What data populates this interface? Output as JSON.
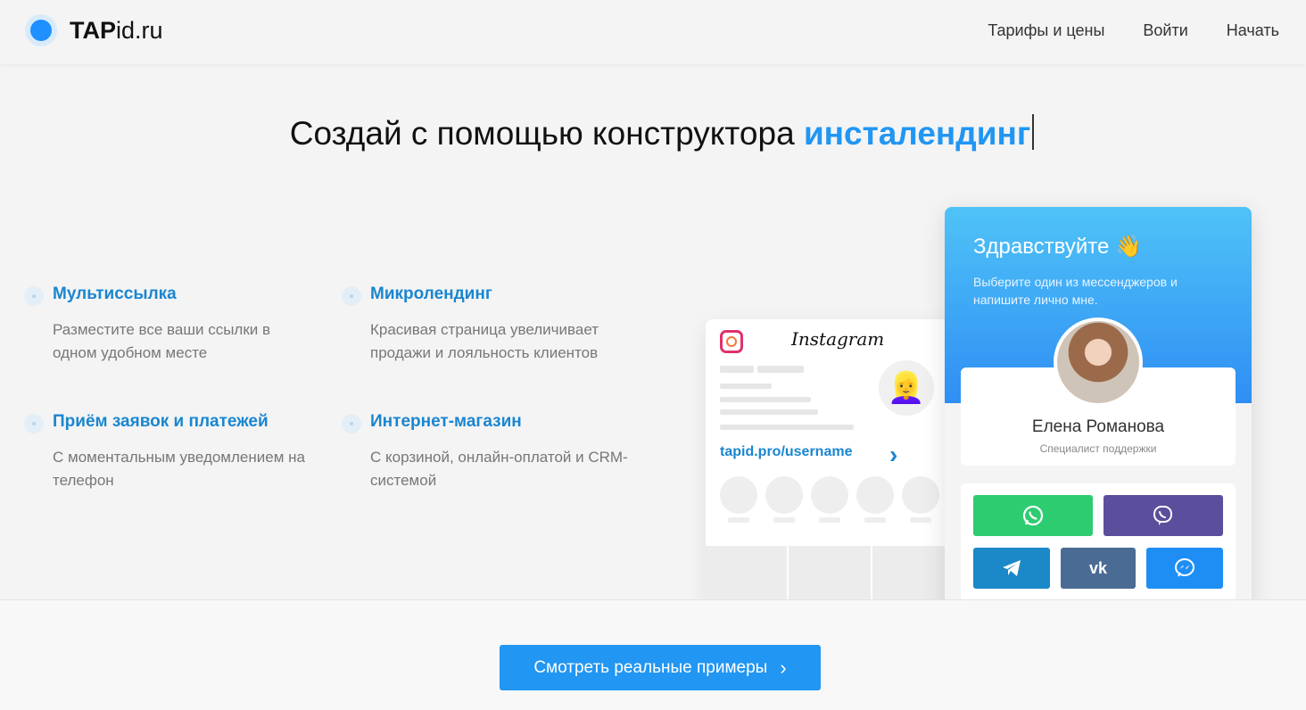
{
  "header": {
    "logo_bold": "TAP",
    "logo_rest": "id.ru",
    "nav": [
      "Тарифы и цены",
      "Войти",
      "Начать"
    ]
  },
  "headline": {
    "text": "Создай с помощью конструктора ",
    "accent": "инсталендинг"
  },
  "features": [
    {
      "title": "Мультиссылка",
      "desc": "Разместите все ваши ссылки в одном удобном месте"
    },
    {
      "title": "Микролендинг",
      "desc": "Красивая страница увеличивает продажи и лояльность клиентов"
    },
    {
      "title": "Приём заявок и платежей",
      "desc": "С моментальным уведомлением на телефон"
    },
    {
      "title": "Интернет-магазин",
      "desc": "С корзиной, онлайн-оплатой и CRM-системой"
    }
  ],
  "instagram": {
    "wordmark": "Instagram",
    "link": "tapid.pro/username",
    "avatar_emoji": "👱‍♀️"
  },
  "profile": {
    "hello": "Здравствуйте 👋",
    "sub": "Выберите один из мессенджеров и напишите лично мне.",
    "name": "Елена Романова",
    "role": "Специалист поддержки",
    "messengers": [
      {
        "name": "whatsapp-icon",
        "color": "#2ecc71"
      },
      {
        "name": "viber-icon",
        "color": "#5b4e9c"
      },
      {
        "name": "telegram-icon",
        "color": "#1b88c8"
      },
      {
        "name": "vk-icon",
        "color": "#4a6b94"
      },
      {
        "name": "messenger-icon",
        "color": "#1e8ef5"
      }
    ]
  },
  "cta": {
    "label": "Смотреть реальные примеры",
    "chevron": "›"
  }
}
